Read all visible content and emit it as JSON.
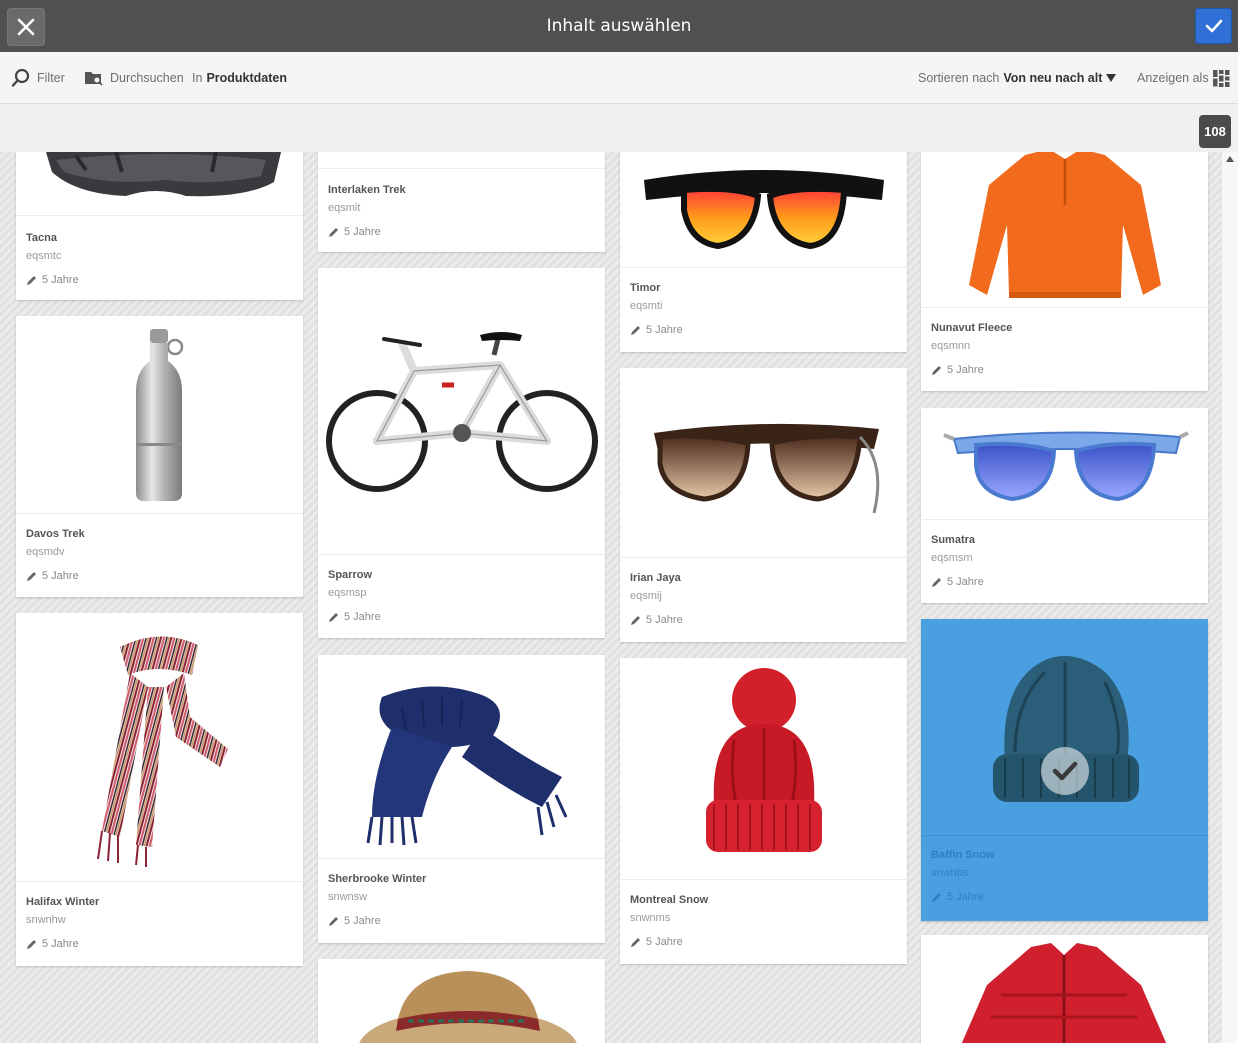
{
  "header": {
    "title": "Inhalt auswählen"
  },
  "toolbar": {
    "filter_label": "Filter",
    "browse_label": "Durchsuchen",
    "in_label": "In",
    "location": "Produktdaten",
    "sort_label": "Sortieren nach",
    "sort_value": "Von neu nach alt",
    "view_label": "Anzeigen als"
  },
  "status": {
    "count": "108"
  },
  "colors": {
    "topbar": "#505050",
    "accent": "#2f6fd6",
    "selected": "#4a9fe0"
  },
  "cards": [
    {
      "title": "Tacna",
      "sku": "eqsmtc",
      "meta": "5 Jahre",
      "icon": "helmet-image"
    },
    {
      "title": "Davos Trek",
      "sku": "eqsmdv",
      "meta": "5 Jahre",
      "icon": "water-bottle-image"
    },
    {
      "title": "Halifax Winter",
      "sku": "snwnhw",
      "meta": "5 Jahre",
      "icon": "striped-scarf-image"
    },
    {
      "title": "Interlaken Trek",
      "sku": "eqsmit",
      "meta": "5 Jahre",
      "icon": ""
    },
    {
      "title": "Sparrow",
      "sku": "eqsmsp",
      "meta": "5 Jahre",
      "icon": "bicycle-image"
    },
    {
      "title": "Sherbrooke Winter",
      "sku": "snwnsw",
      "meta": "5 Jahre",
      "icon": "navy-scarf-image"
    },
    {
      "title": "",
      "sku": "",
      "meta": "",
      "icon": "sun-hat-image"
    },
    {
      "title": "Timor",
      "sku": "eqsmti",
      "meta": "5 Jahre",
      "icon": "sunglasses-image"
    },
    {
      "title": "Irian Jaya",
      "sku": "eqsmij",
      "meta": "5 Jahre",
      "icon": "sunglasses-image"
    },
    {
      "title": "Montreal Snow",
      "sku": "snwnms",
      "meta": "5 Jahre",
      "icon": "red-beanie-image"
    },
    {
      "title": "Nunavut Fleece",
      "sku": "eqsmnn",
      "meta": "5 Jahre",
      "icon": "orange-fleece-image"
    },
    {
      "title": "Sumatra",
      "sku": "eqsmsm",
      "meta": "5 Jahre",
      "icon": "sunglasses-image"
    },
    {
      "title": "Baffin Snow",
      "sku": "snwnbs",
      "meta": "5 Jahre",
      "icon": "blue-beanie-image",
      "selected": true
    },
    {
      "title": "",
      "sku": "",
      "meta": "",
      "icon": "red-jacket-image"
    }
  ]
}
